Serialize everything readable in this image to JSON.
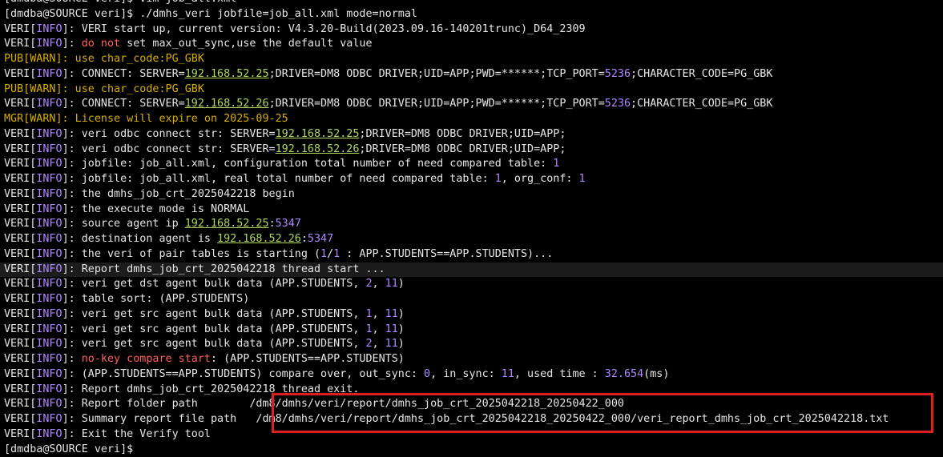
{
  "terminal": {
    "lines": [
      {
        "segments": [
          {
            "t": "[dmdba@SOURCE veri]$ vim job_all.xml",
            "c": "default"
          }
        ]
      },
      {
        "segments": [
          {
            "t": "[dmdba@SOURCE veri]$ ",
            "c": "default"
          },
          {
            "t": "./dmhs_veri jobfile=job_all.xml mode=normal",
            "c": "default"
          }
        ]
      },
      {
        "segments": [
          {
            "t": "VERI",
            "c": "default"
          },
          {
            "t": "[",
            "c": "default"
          },
          {
            "t": "INFO",
            "c": "purple"
          },
          {
            "t": "]: VERI start up, current version: V4.3.20-Build(2023.09.16-140201trunc)_D64_2309",
            "c": "default"
          }
        ]
      },
      {
        "segments": [
          {
            "t": "VERI",
            "c": "default"
          },
          {
            "t": "[",
            "c": "default"
          },
          {
            "t": "INFO",
            "c": "purple"
          },
          {
            "t": "]: ",
            "c": "default"
          },
          {
            "t": "do not",
            "c": "red"
          },
          {
            "t": " set max_out_sync,use the default value",
            "c": "default"
          }
        ]
      },
      {
        "segments": [
          {
            "t": "PUB[WARN]: use char_code:PG_GBK",
            "c": "yellow"
          }
        ]
      },
      {
        "segments": [
          {
            "t": "VERI",
            "c": "default"
          },
          {
            "t": "[",
            "c": "default"
          },
          {
            "t": "INFO",
            "c": "purple"
          },
          {
            "t": "]: CONNECT: SERVER=",
            "c": "default"
          },
          {
            "t": "192.168.52.25",
            "c": "green"
          },
          {
            "t": ";DRIVER=DM8 ODBC DRIVER;UID=APP;PWD=******;TCP_PORT=",
            "c": "default"
          },
          {
            "t": "5236",
            "c": "purple"
          },
          {
            "t": ";CHARACTER_CODE=PG_GBK",
            "c": "default"
          }
        ]
      },
      {
        "segments": [
          {
            "t": "PUB[WARN]: use char_code:PG_GBK",
            "c": "yellow"
          }
        ]
      },
      {
        "segments": [
          {
            "t": "VERI",
            "c": "default"
          },
          {
            "t": "[",
            "c": "default"
          },
          {
            "t": "INFO",
            "c": "purple"
          },
          {
            "t": "]: CONNECT: SERVER=",
            "c": "default"
          },
          {
            "t": "192.168.52.26",
            "c": "green"
          },
          {
            "t": ";DRIVER=DM8 ODBC DRIVER;UID=APP;PWD=******;TCP_PORT=",
            "c": "default"
          },
          {
            "t": "5236",
            "c": "purple"
          },
          {
            "t": ";CHARACTER_CODE=PG_GBK",
            "c": "default"
          }
        ]
      },
      {
        "segments": [
          {
            "t": "MGR[WARN]: License will expire on 2025-09-25",
            "c": "yellow"
          }
        ]
      },
      {
        "segments": [
          {
            "t": "VERI",
            "c": "default"
          },
          {
            "t": "[",
            "c": "default"
          },
          {
            "t": "INFO",
            "c": "purple"
          },
          {
            "t": "]: veri odbc connect str: SERVER=",
            "c": "default"
          },
          {
            "t": "192.168.52.25",
            "c": "green"
          },
          {
            "t": ";DRIVER=DM8 ODBC DRIVER;UID=APP;",
            "c": "default"
          }
        ]
      },
      {
        "segments": [
          {
            "t": "VERI",
            "c": "default"
          },
          {
            "t": "[",
            "c": "default"
          },
          {
            "t": "INFO",
            "c": "purple"
          },
          {
            "t": "]: veri odbc connect str: SERVER=",
            "c": "default"
          },
          {
            "t": "192.168.52.26",
            "c": "green"
          },
          {
            "t": ";DRIVER=DM8 ODBC DRIVER;UID=APP;",
            "c": "default"
          }
        ]
      },
      {
        "segments": [
          {
            "t": "VERI",
            "c": "default"
          },
          {
            "t": "[",
            "c": "default"
          },
          {
            "t": "INFO",
            "c": "purple"
          },
          {
            "t": "]: jobfile: job_all.xml, configuration total number of need compared table: ",
            "c": "default"
          },
          {
            "t": "1",
            "c": "purple"
          }
        ]
      },
      {
        "segments": [
          {
            "t": "VERI",
            "c": "default"
          },
          {
            "t": "[",
            "c": "default"
          },
          {
            "t": "INFO",
            "c": "purple"
          },
          {
            "t": "]: jobfile: job_all.xml, real total number of need compared table: ",
            "c": "default"
          },
          {
            "t": "1",
            "c": "purple"
          },
          {
            "t": ", org_conf: ",
            "c": "default"
          },
          {
            "t": "1",
            "c": "purple"
          }
        ]
      },
      {
        "segments": [
          {
            "t": "VERI",
            "c": "default"
          },
          {
            "t": "[",
            "c": "default"
          },
          {
            "t": "INFO",
            "c": "purple"
          },
          {
            "t": "]: the dmhs_job_crt_2025042218 begin",
            "c": "default"
          }
        ]
      },
      {
        "segments": [
          {
            "t": "VERI",
            "c": "default"
          },
          {
            "t": "[",
            "c": "default"
          },
          {
            "t": "INFO",
            "c": "purple"
          },
          {
            "t": "]: the execute mode is NORMAL",
            "c": "default"
          }
        ]
      },
      {
        "segments": [
          {
            "t": "VERI",
            "c": "default"
          },
          {
            "t": "[",
            "c": "default"
          },
          {
            "t": "INFO",
            "c": "purple"
          },
          {
            "t": "]: source agent ip ",
            "c": "default"
          },
          {
            "t": "192.168.52.25",
            "c": "green"
          },
          {
            "t": ":",
            "c": "default"
          },
          {
            "t": "5347",
            "c": "purple"
          }
        ]
      },
      {
        "segments": [
          {
            "t": "VERI",
            "c": "default"
          },
          {
            "t": "[",
            "c": "default"
          },
          {
            "t": "INFO",
            "c": "purple"
          },
          {
            "t": "]: destination agent is ",
            "c": "default"
          },
          {
            "t": "192.168.52.26",
            "c": "green"
          },
          {
            "t": ":",
            "c": "default"
          },
          {
            "t": "5347",
            "c": "purple"
          }
        ]
      },
      {
        "segments": [
          {
            "t": "VERI",
            "c": "default"
          },
          {
            "t": "[",
            "c": "default"
          },
          {
            "t": "INFO",
            "c": "purple"
          },
          {
            "t": "]: the veri of pair tables is starting (",
            "c": "default"
          },
          {
            "t": "1",
            "c": "purple"
          },
          {
            "t": "/",
            "c": "default"
          },
          {
            "t": "1",
            "c": "purple"
          },
          {
            "t": " : APP.STUDENTS==APP.STUDENTS)...",
            "c": "default"
          }
        ]
      },
      {
        "hl": true,
        "segments": [
          {
            "t": "VERI",
            "c": "default"
          },
          {
            "t": "[",
            "c": "default"
          },
          {
            "t": "INFO",
            "c": "purple"
          },
          {
            "t": "]: Report dmhs_job_crt_2025042218 thread start ...",
            "c": "default"
          }
        ]
      },
      {
        "segments": [
          {
            "t": "VERI",
            "c": "default"
          },
          {
            "t": "[",
            "c": "default"
          },
          {
            "t": "INFO",
            "c": "purple"
          },
          {
            "t": "]: veri get dst agent bulk data (APP.STUDENTS, ",
            "c": "default"
          },
          {
            "t": "2",
            "c": "purple"
          },
          {
            "t": ", ",
            "c": "default"
          },
          {
            "t": "11",
            "c": "purple"
          },
          {
            "t": ")",
            "c": "default"
          }
        ]
      },
      {
        "segments": [
          {
            "t": "VERI",
            "c": "default"
          },
          {
            "t": "[",
            "c": "default"
          },
          {
            "t": "INFO",
            "c": "purple"
          },
          {
            "t": "]: table sort: (APP.STUDENTS)",
            "c": "default"
          }
        ]
      },
      {
        "segments": [
          {
            "t": "VERI",
            "c": "default"
          },
          {
            "t": "[",
            "c": "default"
          },
          {
            "t": "INFO",
            "c": "purple"
          },
          {
            "t": "]: veri get src agent bulk data (APP.STUDENTS, ",
            "c": "default"
          },
          {
            "t": "1",
            "c": "purple"
          },
          {
            "t": ", ",
            "c": "default"
          },
          {
            "t": "11",
            "c": "purple"
          },
          {
            "t": ")",
            "c": "default"
          }
        ]
      },
      {
        "segments": [
          {
            "t": "VERI",
            "c": "default"
          },
          {
            "t": "[",
            "c": "default"
          },
          {
            "t": "INFO",
            "c": "purple"
          },
          {
            "t": "]: veri get src agent bulk data (APP.STUDENTS, ",
            "c": "default"
          },
          {
            "t": "1",
            "c": "purple"
          },
          {
            "t": ", ",
            "c": "default"
          },
          {
            "t": "11",
            "c": "purple"
          },
          {
            "t": ")",
            "c": "default"
          }
        ]
      },
      {
        "segments": [
          {
            "t": "VERI",
            "c": "default"
          },
          {
            "t": "[",
            "c": "default"
          },
          {
            "t": "INFO",
            "c": "purple"
          },
          {
            "t": "]: veri get src agent bulk data (APP.STUDENTS, ",
            "c": "default"
          },
          {
            "t": "2",
            "c": "purple"
          },
          {
            "t": ", ",
            "c": "default"
          },
          {
            "t": "11",
            "c": "purple"
          },
          {
            "t": ")",
            "c": "default"
          }
        ]
      },
      {
        "segments": [
          {
            "t": "VERI",
            "c": "default"
          },
          {
            "t": "[",
            "c": "default"
          },
          {
            "t": "INFO",
            "c": "purple"
          },
          {
            "t": "]: ",
            "c": "default"
          },
          {
            "t": "no-key compare start",
            "c": "red"
          },
          {
            "t": ": (APP.STUDENTS==APP.STUDENTS)",
            "c": "default"
          }
        ]
      },
      {
        "segments": [
          {
            "t": "VERI",
            "c": "default"
          },
          {
            "t": "[",
            "c": "default"
          },
          {
            "t": "INFO",
            "c": "purple"
          },
          {
            "t": "]: (APP.STUDENTS==APP.STUDENTS) compare over, out_sync: ",
            "c": "default"
          },
          {
            "t": "0",
            "c": "purple"
          },
          {
            "t": ", in_sync: ",
            "c": "default"
          },
          {
            "t": "11",
            "c": "purple"
          },
          {
            "t": ", used time : ",
            "c": "default"
          },
          {
            "t": "32.654",
            "c": "purple"
          },
          {
            "t": "(ms)",
            "c": "default"
          }
        ]
      },
      {
        "segments": [
          {
            "t": "VERI",
            "c": "default"
          },
          {
            "t": "[",
            "c": "default"
          },
          {
            "t": "INFO",
            "c": "purple"
          },
          {
            "t": "]: Report dmhs_job_crt_2025042218 thread exit.",
            "c": "default"
          }
        ]
      },
      {
        "segments": [
          {
            "t": "VERI",
            "c": "default"
          },
          {
            "t": "[",
            "c": "default"
          },
          {
            "t": "INFO",
            "c": "purple"
          },
          {
            "t": "]: Report folder path        /dm8/dmhs/veri/report/dmhs_job_crt_2025042218_20250422_000",
            "c": "default"
          }
        ]
      },
      {
        "segments": [
          {
            "t": "VERI",
            "c": "default"
          },
          {
            "t": "[",
            "c": "default"
          },
          {
            "t": "INFO",
            "c": "purple"
          },
          {
            "t": "]: Summary report file path   /dm8/dmhs/veri/report/dmhs_job_crt_2025042218_20250422_000/veri_report_dmhs_job_crt_2025042218.txt",
            "c": "default"
          }
        ]
      },
      {
        "segments": [
          {
            "t": "VERI",
            "c": "default"
          },
          {
            "t": "[",
            "c": "default"
          },
          {
            "t": "INFO",
            "c": "purple"
          },
          {
            "t": "]: Exit the Verify tool",
            "c": "default"
          }
        ]
      },
      {
        "segments": [
          {
            "t": "[dmdba@SOURCE veri]$ ",
            "c": "default"
          }
        ]
      }
    ]
  },
  "colors": {
    "background": "#000000",
    "text": "#e6e6e6",
    "info_tag": "#af87ff",
    "warn": "#d7af00",
    "error_red": "#ff5f5f",
    "ip_green": "#afd75f",
    "annotation_box": "#e01e1e"
  }
}
